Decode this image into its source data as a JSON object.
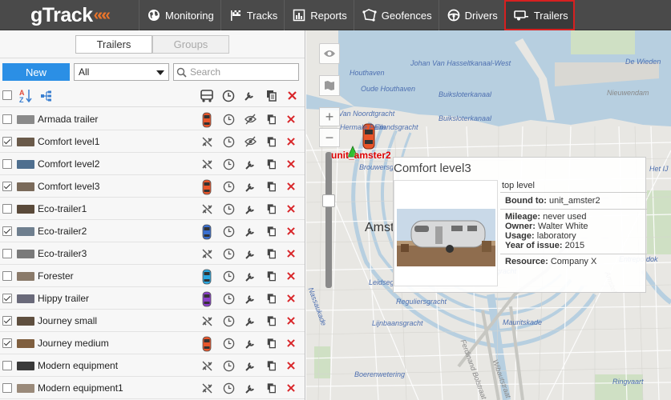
{
  "app": {
    "logo": "gTrack",
    "logo_chevrons": "«««"
  },
  "nav": [
    {
      "label": "Monitoring",
      "icon": "globe-icon"
    },
    {
      "label": "Tracks",
      "icon": "flag-icon"
    },
    {
      "label": "Reports",
      "icon": "chart-icon"
    },
    {
      "label": "Geofences",
      "icon": "geofence-icon"
    },
    {
      "label": "Drivers",
      "icon": "steering-wheel-icon"
    },
    {
      "label": "Trailers",
      "icon": "trailer-icon",
      "active": true
    }
  ],
  "panel": {
    "tabs": [
      {
        "label": "Trailers",
        "active": true
      },
      {
        "label": "Groups",
        "active": false
      }
    ],
    "new_label": "New",
    "filter_value": "All",
    "search_placeholder": "Search"
  },
  "rows": [
    {
      "name": "Armada trailer",
      "checked": false,
      "bound": true,
      "unit_color": "#e8552a"
    },
    {
      "name": "Comfort level1",
      "checked": true,
      "bound": false,
      "unit_color": ""
    },
    {
      "name": "Comfort level2",
      "checked": false,
      "bound": false,
      "unit_color": ""
    },
    {
      "name": "Comfort level3",
      "checked": true,
      "bound": true,
      "unit_color": "#e8552a"
    },
    {
      "name": "Eco-trailer1",
      "checked": false,
      "bound": false,
      "unit_color": ""
    },
    {
      "name": "Eco-trailer2",
      "checked": true,
      "bound": true,
      "unit_color": "#3a6fd0"
    },
    {
      "name": "Eco-trailer3",
      "checked": false,
      "bound": false,
      "unit_color": ""
    },
    {
      "name": "Forester",
      "checked": false,
      "bound": true,
      "unit_color": "#2aa7e0"
    },
    {
      "name": "Hippy trailer",
      "checked": true,
      "bound": true,
      "unit_color": "#8b3fc9"
    },
    {
      "name": "Journey small",
      "checked": true,
      "bound": false,
      "unit_color": ""
    },
    {
      "name": "Journey medium",
      "checked": true,
      "bound": true,
      "unit_color": "#e8552a"
    },
    {
      "name": "Modern equipment",
      "checked": false,
      "bound": false,
      "unit_color": ""
    },
    {
      "name": "Modern equipment1",
      "checked": false,
      "bound": false,
      "unit_color": ""
    }
  ],
  "map": {
    "labels": [
      "Houthaven",
      "Johan Van Hasseltkanaal-West",
      "De Wieden",
      "Oude Houthaven",
      "Buiksloterkanaal",
      "Nieuwendam",
      "Buiksloterkanaal",
      "Van Noordtgracht",
      "Hermale Palm",
      "Eilandsgracht",
      "Brouwersg",
      "Amst",
      "Leidsegracht",
      "Nieuwe Herengracht",
      "Reguliersgracht",
      "Lijnbaansgracht",
      "Mauritskade",
      "Boerenwetering",
      "Ringvaart",
      "Het IJ",
      "Entrepotdok",
      "Nassaukade",
      "Ferdinand Bolstraat",
      "Wibautstraat",
      "Amstel"
    ],
    "unit_label": "unit_amster2"
  },
  "popup": {
    "title": "Comfort level3",
    "level": "top level",
    "bound_label": "Bound to:",
    "bound_value": "unit_amster2",
    "mileage_label": "Mileage:",
    "mileage_value": "never used",
    "owner_label": "Owner:",
    "owner_value": "Walter White",
    "usage_label": "Usage:",
    "usage_value": "laboratory",
    "year_label": "Year of issue:",
    "year_value": "2015",
    "resource_label": "Resource:",
    "resource_value": "Company X"
  }
}
